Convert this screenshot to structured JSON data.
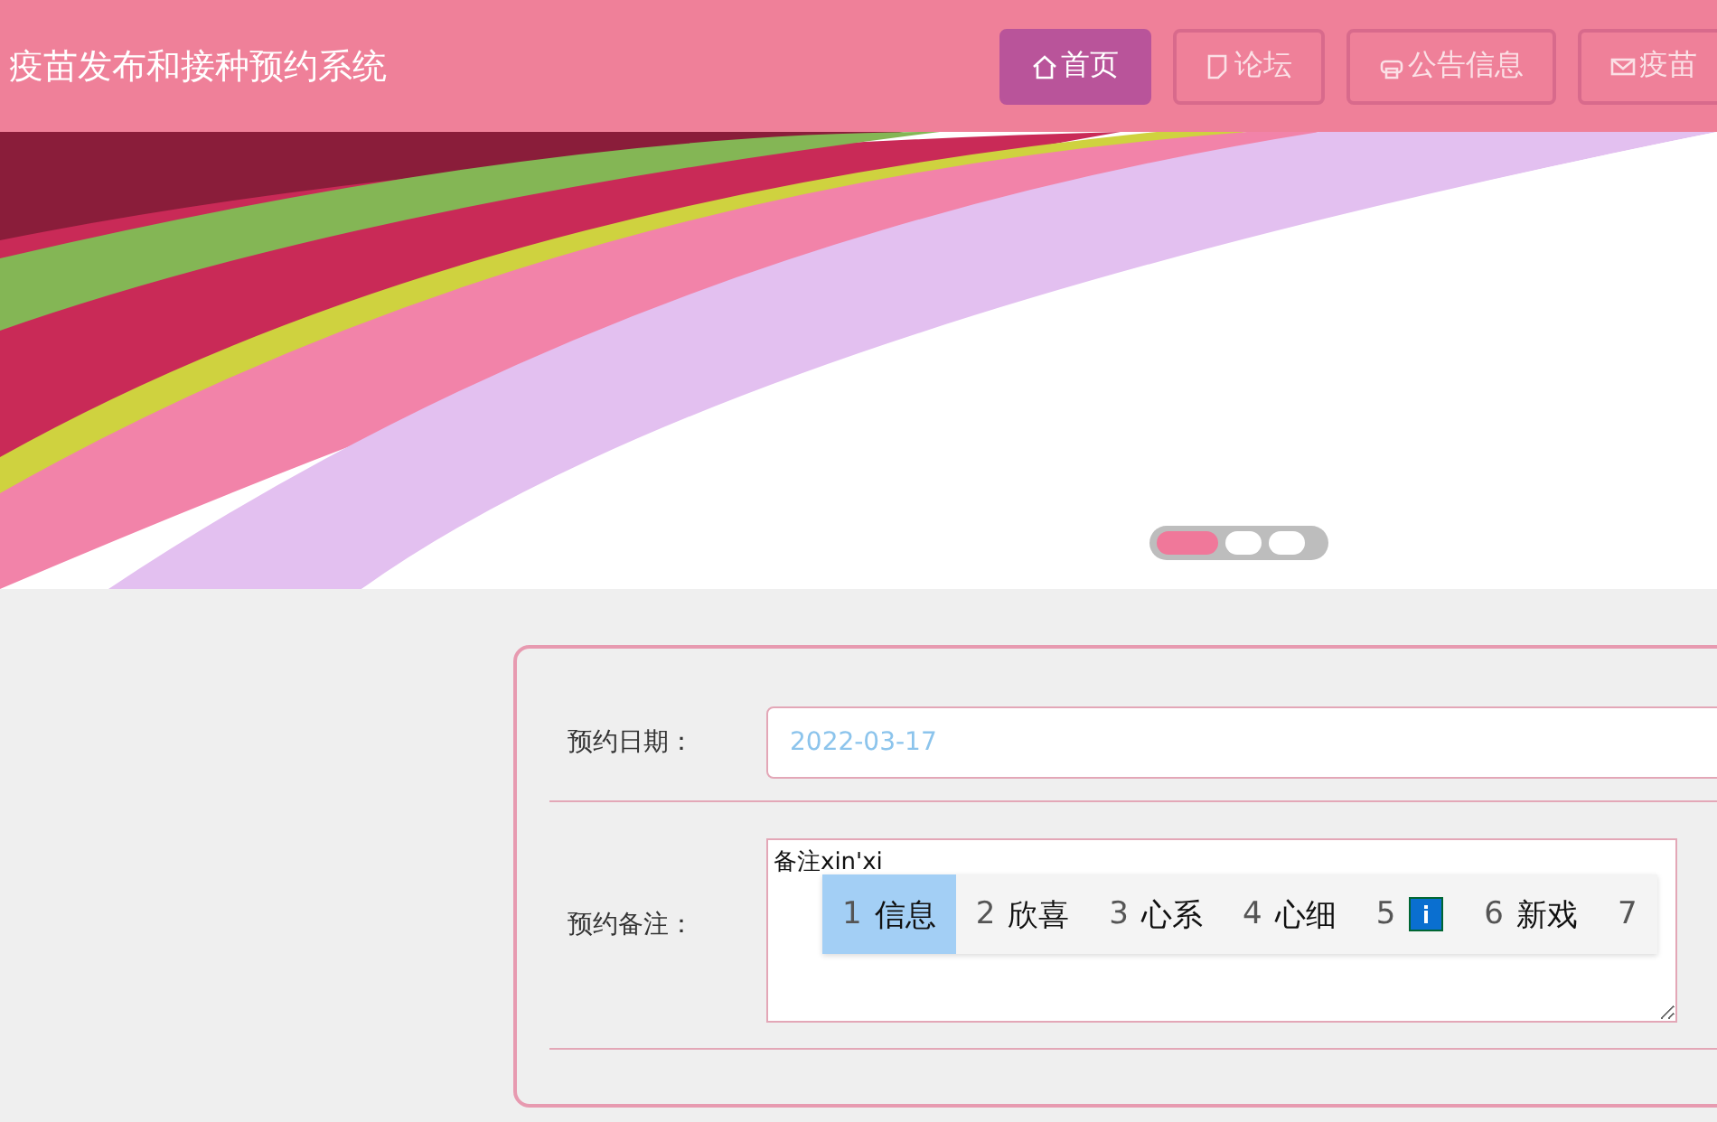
{
  "header": {
    "title": "疫苗发布和接种预约系统"
  },
  "nav": [
    {
      "label": "首页",
      "selected": true
    },
    {
      "label": "论坛",
      "selected": false
    },
    {
      "label": "公告信息",
      "selected": false
    },
    {
      "label": "疫苗",
      "selected": false
    }
  ],
  "banner": {
    "kind": "picture",
    "dots": [
      {
        "selected": true
      },
      {
        "selected": false
      },
      {
        "selected": false
      }
    ]
  },
  "form": {
    "fields": [
      {
        "label": "预约日期：",
        "kind": "input",
        "value": "2022-03-17"
      },
      {
        "label": "预约备注：",
        "kind": "textarea",
        "value": "备注xin'xi"
      }
    ]
  },
  "ime": {
    "candidates": [
      {
        "number": "1",
        "kind": "text",
        "text": "信息",
        "selected": true
      },
      {
        "number": "2",
        "kind": "text",
        "text": "欣喜",
        "selected": false
      },
      {
        "number": "3",
        "kind": "text",
        "text": "心系",
        "selected": false
      },
      {
        "number": "4",
        "kind": "text",
        "text": "心细",
        "selected": false
      },
      {
        "number": "5",
        "kind": "icon",
        "selected": false
      },
      {
        "number": "6",
        "kind": "text",
        "text": "新戏",
        "selected": false
      },
      {
        "number": "7",
        "kind": "text",
        "selected": false
      }
    ]
  }
}
